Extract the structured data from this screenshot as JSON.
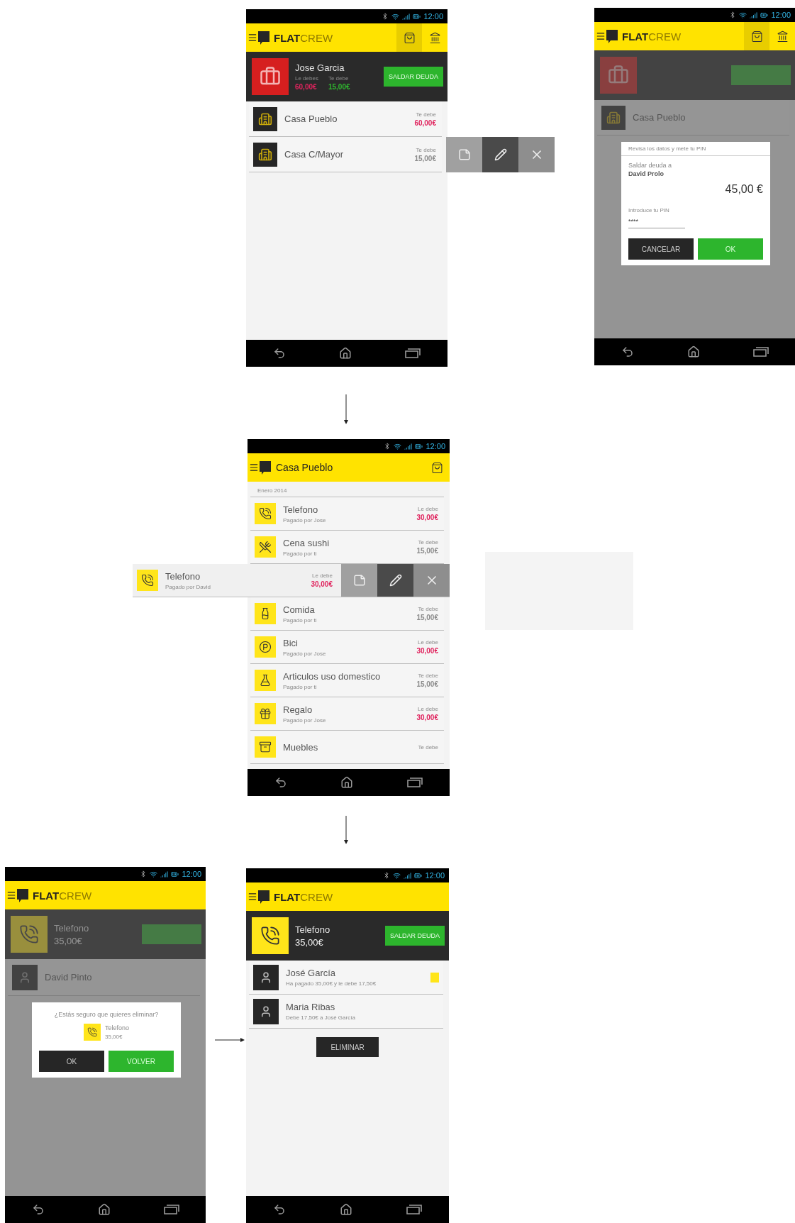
{
  "screens": [
    {
      "kind": "accounts",
      "status_time": "12:00",
      "brand": {
        "strong": "FLAT",
        "light": "CREW"
      },
      "actions": [
        {
          "selected": true
        },
        {
          "selected": false
        }
      ],
      "header": {
        "name": "Jose Garcia",
        "balances": [
          {
            "label": "Le debes",
            "value": "60,00€",
            "color": "#e0245e"
          },
          {
            "label": "Te debe",
            "value": "15,00€",
            "color": "#2fb52f"
          }
        ],
        "button": "SALDAR DEUDA"
      },
      "rows": [
        {
          "name": "Casa Pueblo",
          "label": "Te debe",
          "value": "60,00€",
          "color": "#e0245e",
          "swiped": false
        },
        {
          "name": "Casa C/Mayor",
          "label": "Te debe",
          "value": "15,00€",
          "color": "#8c8c8c",
          "swiped": true
        }
      ]
    },
    {
      "kind": "pay_dialog",
      "status_time": "12:00",
      "brand": {
        "strong": "FLAT",
        "light": "CREW"
      },
      "actions": [
        {
          "selected": true
        },
        {
          "selected": false
        }
      ],
      "background": {
        "rows": [
          "Casa Pueblo"
        ]
      },
      "dialog": {
        "title": "Revisa los datos y mete tu PIN",
        "text": "Saldar deuda a",
        "person": "David Prolo",
        "amount": "45,00 €",
        "pin_label": "Introduce tu PIN",
        "pin_value": "****",
        "buttons": [
          {
            "label": "CANCELAR",
            "kind": "secondary"
          },
          {
            "label": "OK",
            "kind": "primary"
          }
        ]
      }
    },
    {
      "kind": "expenses",
      "status_time": "12:00",
      "title": "Casa Pueblo",
      "actions": [
        {
          "selected": false
        }
      ],
      "section": "Enero 2014",
      "items": [
        {
          "name": "Telefono",
          "paid_by": "Pagado por Jose",
          "label": "Le debe",
          "value": "30,00€",
          "color": "#e0245e",
          "kind": "phone",
          "swiped": false
        },
        {
          "name": "Cena sushi",
          "paid_by": "Pagado por ti",
          "label": "Te debe",
          "value": "15,00€",
          "color": "#8c8c8c",
          "kind": "plate",
          "swiped": false
        },
        {
          "name": "Telefono",
          "paid_by": "Pagado por David",
          "label": "Le debe",
          "value": "30,00€",
          "color": "#e0245e",
          "kind": "phone",
          "swiped": true
        },
        {
          "name": "Comida",
          "paid_by": "Pagado por ti",
          "label": "Te debe",
          "value": "15,00€",
          "color": "#8c8c8c",
          "kind": "bottles",
          "swiped": false
        },
        {
          "name": "Bici",
          "paid_by": "Pagado por Jose",
          "label": "Le debe",
          "value": "30,00€",
          "color": "#e0245e",
          "kind": "parking",
          "swiped": false
        },
        {
          "name": "Articulos uso domestico",
          "paid_by": "Pagado por ti",
          "label": "Te debe",
          "value": "15,00€",
          "color": "#8c8c8c",
          "kind": "bottle",
          "swiped": false
        },
        {
          "name": "Regalo",
          "paid_by": "Pagado por Jose",
          "label": "Le debe",
          "value": "30,00€",
          "color": "#e0245e",
          "kind": "gift",
          "swiped": false
        },
        {
          "name": "Muebles",
          "label": "Te debe",
          "kind": "shelves",
          "swiped": false
        }
      ]
    },
    {
      "kind": "delete_dialog",
      "status_time": "12:00",
      "brand": {
        "strong": "FLAT",
        "light": "CREW"
      },
      "background": {
        "name": "Telefono",
        "amount": "35,00€",
        "rows": [
          "David Pinto"
        ]
      },
      "dialog": {
        "text": "¿Estás seguro que quieres eliminar?",
        "item": {
          "name": "Telefono",
          "value": "35,00€"
        },
        "buttons": [
          {
            "label": "OK",
            "kind": "secondary"
          },
          {
            "label": "VOLVER",
            "kind": "primary"
          }
        ]
      }
    },
    {
      "kind": "expense_detail",
      "status_time": "12:00",
      "brand": {
        "strong": "FLAT",
        "light": "CREW"
      },
      "header": {
        "name": "Telefono",
        "amount": "35,00€",
        "button": "SALDAR DEUDA"
      },
      "members": [
        {
          "name": "José García",
          "detail": "Ha pagado 35,00€ y le debe 17,50€",
          "badge": true
        },
        {
          "name": "Maria Ribas",
          "detail": "Debe 17,50€ a José García",
          "badge": false
        }
      ],
      "button": "ELIMINAR"
    }
  ]
}
